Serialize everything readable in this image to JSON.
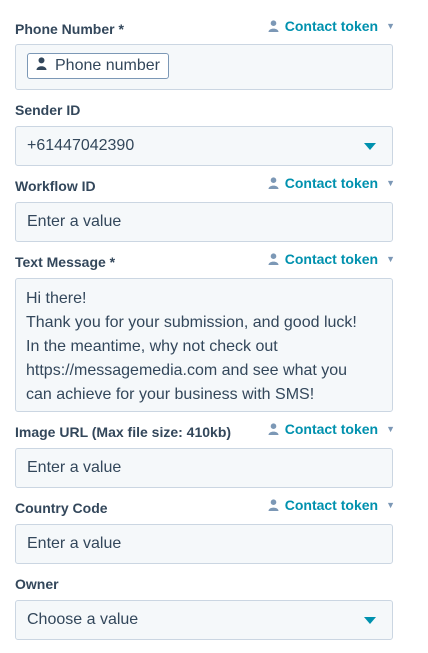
{
  "token_label": "Contact token",
  "fields": {
    "phone_number": {
      "label": "Phone Number *",
      "chip_text": "Phone number"
    },
    "sender_id": {
      "label": "Sender ID",
      "value": "+61447042390"
    },
    "workflow_id": {
      "label": "Workflow ID",
      "placeholder": "Enter a value"
    },
    "text_message": {
      "label": "Text Message *",
      "value": "Hi there!\nThank you for your submission, and good luck!\nIn the meantime, why not check out\nhttps://messagemedia.com and see what you\ncan achieve for your business with SMS!"
    },
    "image_url": {
      "label": "Image URL (Max file size: 410kb)",
      "placeholder": "Enter a value"
    },
    "country_code": {
      "label": "Country Code",
      "placeholder": "Enter a value"
    },
    "owner": {
      "label": "Owner",
      "placeholder": "Choose a value"
    }
  },
  "colors": {
    "accent": "#0091ae",
    "text": "#33475b",
    "field_bg": "#f5f8fa",
    "field_border": "#cbd6e2"
  },
  "icons": {
    "token": "person-icon",
    "token_caret": "caret-down-icon",
    "dropdown": "chevron-down-icon"
  }
}
